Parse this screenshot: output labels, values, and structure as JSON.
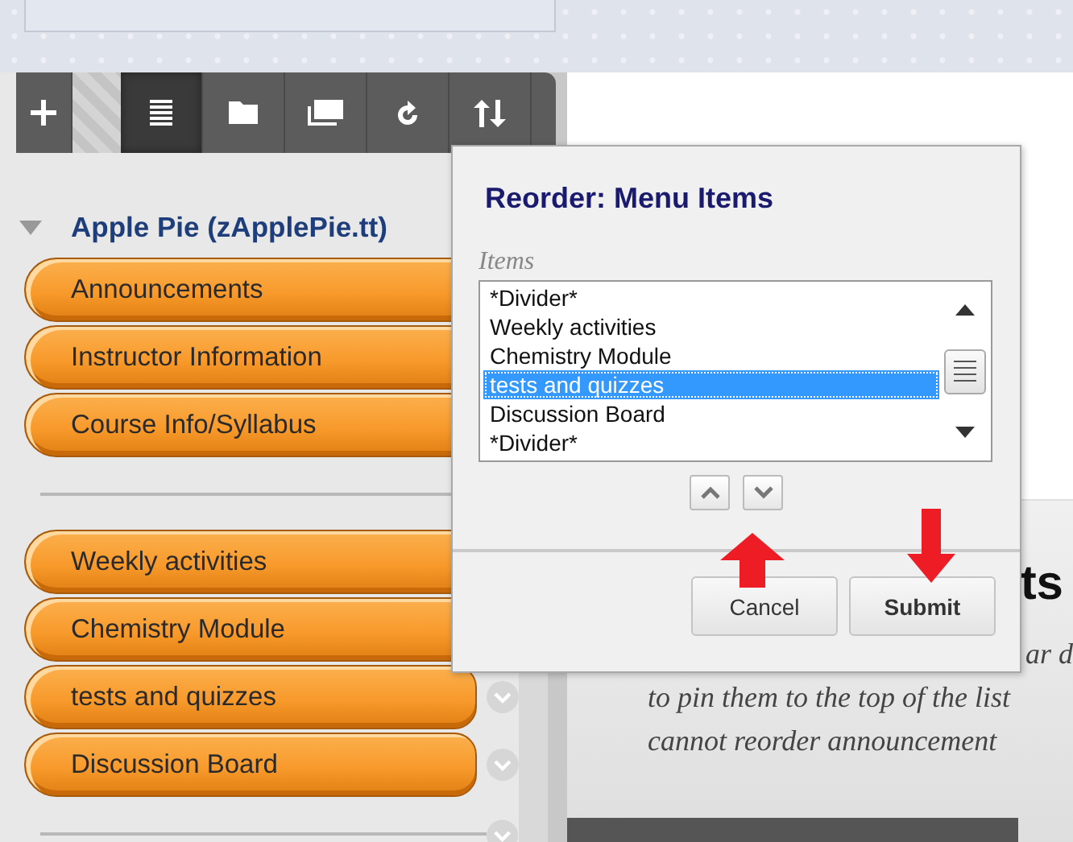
{
  "toolbar": [
    {
      "kind": "add",
      "selected": false
    },
    {
      "kind": "list",
      "selected": true
    },
    {
      "kind": "folder",
      "selected": false
    },
    {
      "kind": "window",
      "selected": false
    },
    {
      "kind": "refresh",
      "selected": false
    },
    {
      "kind": "sort",
      "selected": false
    }
  ],
  "course": {
    "title": "Apple Pie (zApplePie.tt)",
    "expanded": true
  },
  "sidebar": {
    "items": [
      {
        "kind": "link",
        "label": "Announcements",
        "chevron": false
      },
      {
        "kind": "link",
        "label": "Instructor Information",
        "chevron": false
      },
      {
        "kind": "link",
        "label": "Course Info/Syllabus",
        "chevron": false
      },
      {
        "kind": "divider",
        "chevron": false
      },
      {
        "kind": "link",
        "label": "Weekly activities",
        "chevron": false
      },
      {
        "kind": "link",
        "label": "Chemistry Module",
        "chevron": false
      },
      {
        "kind": "link",
        "label": "tests and quizzes",
        "chevron": true
      },
      {
        "kind": "link",
        "label": "Discussion Board",
        "chevron": true
      },
      {
        "kind": "divider",
        "chevron": true
      }
    ]
  },
  "content": {
    "heading": "ts",
    "lines": [
      "ar d",
      "to pin them to the top of the list",
      "cannot reorder announcement"
    ]
  },
  "dialog": {
    "title": "Reorder: Menu Items",
    "list_label": "Items",
    "list_items": [
      {
        "label": "*Divider*",
        "selected": false
      },
      {
        "label": "Weekly activities",
        "selected": false
      },
      {
        "label": "Chemistry Module",
        "selected": false
      },
      {
        "label": "tests and quizzes",
        "selected": true
      },
      {
        "label": "Discussion Board",
        "selected": false
      },
      {
        "label": "*Divider*",
        "selected": false
      }
    ],
    "buttons": [
      {
        "kind": "cancel",
        "label": "Cancel"
      },
      {
        "kind": "submit",
        "label": "Submit"
      }
    ]
  },
  "annotation_arrows": [
    {
      "kind": "up"
    },
    {
      "kind": "down"
    }
  ]
}
